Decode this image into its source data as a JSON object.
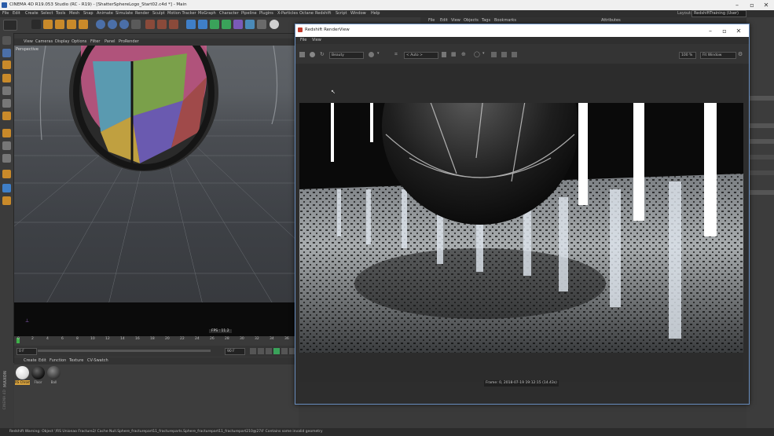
{
  "window": {
    "title": "CINEMA 4D R19.053 Studio (RC - R19) - [ShatterSphereLogo_Start02.c4d *] - Main"
  },
  "menu": [
    "File",
    "Edit",
    "Create",
    "Select",
    "Tools",
    "Mesh",
    "Snap",
    "Animate",
    "Simulate",
    "Render",
    "Sculpt",
    "Motion Tracker",
    "MoGraph",
    "Character",
    "Pipeline",
    "Plugins",
    "X-Particles",
    "Octane",
    "Redshift",
    "Script",
    "Window",
    "Help"
  ],
  "layout": {
    "label": "Layout:",
    "value": "RedshiftTraining (User)"
  },
  "viewport": {
    "menu": [
      "View",
      "Cameras",
      "Display",
      "Options",
      "Filter",
      "Panel",
      "ProRender"
    ],
    "camera_label": "Perspective",
    "fps": "FPS : 11.2"
  },
  "timeline": {
    "ticks": [
      "0",
      "2",
      "4",
      "6",
      "8",
      "10",
      "12",
      "14",
      "16",
      "18",
      "20",
      "22",
      "24",
      "26",
      "28",
      "30",
      "32",
      "34",
      "36"
    ],
    "current_frame": "0 F",
    "end_frame": "90 F"
  },
  "materials": {
    "menu": [
      "Create",
      "Edit",
      "Function",
      "Texture",
      "CV-Swatch"
    ],
    "items": [
      "RS Chrome",
      "Floor",
      "Ball"
    ]
  },
  "status_text": "Redshift Warning: Object '/RS Unionao Fracture2/ Cache Null.Sphere_fracturepart11_fractureparts.Sphere_fracturepart11_fracturepart210@274' Contains some invalid geometry",
  "object_manager": {
    "menu": [
      "File",
      "Edit",
      "View",
      "Objects",
      "Tags",
      "Bookmarks"
    ]
  },
  "attributes": {
    "label": "Attributes"
  },
  "render_view": {
    "title": "Redshift RenderView",
    "menu": [
      "File",
      "View"
    ],
    "aov": "Beauty",
    "camera": "< Auto >",
    "zoom": "100 %",
    "fit": "Fit Window",
    "frame_info": "Frame: 0,  2018-07-19  19:12:15  (14.43s)"
  },
  "maxon": {
    "brand": "MAXON",
    "product": "CINEMA 4D"
  },
  "colors": {
    "accent": "#6a8fc0",
    "active_frame": "#d7a13d"
  }
}
